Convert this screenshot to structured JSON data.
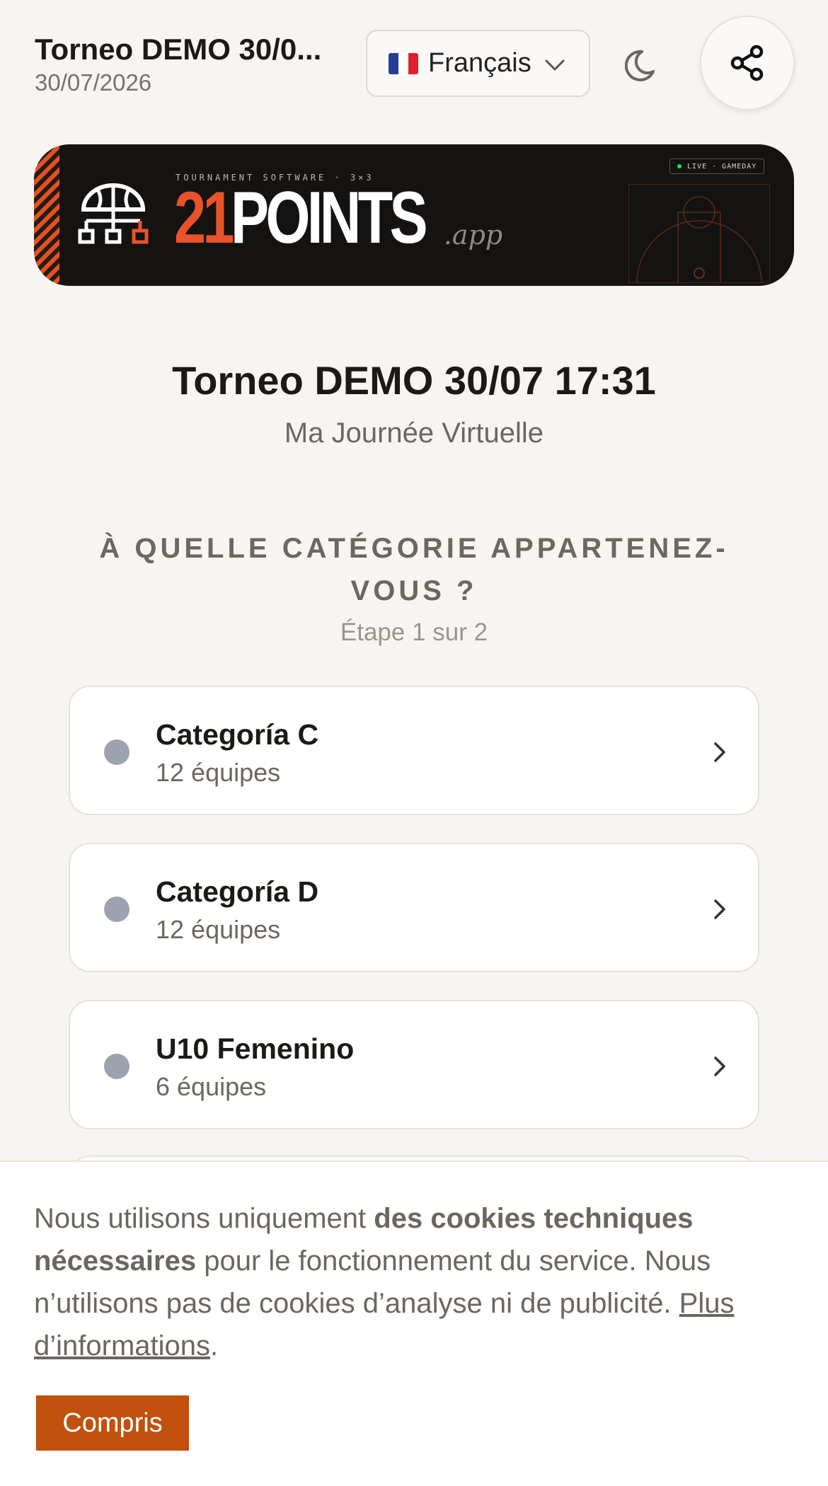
{
  "header": {
    "title": "Torneo DEMO 30/0...",
    "date": "30/07/2026",
    "language": {
      "selected": "Français",
      "flag_icon": "french-flag-icon"
    },
    "theme_icon": "moon-icon",
    "share_icon": "share-icon"
  },
  "banner": {
    "tagline": "TOURNAMENT SOFTWARE · 3×3",
    "brand_number": "21",
    "brand_word": "POINTS",
    "brand_suffix": ".app",
    "live_badge": "LIVE · GAMEDAY",
    "accent_color": "#e8532a"
  },
  "event": {
    "title": "Torneo DEMO 30/07 17:31",
    "subtitle": "Ma Journée Virtuelle"
  },
  "wizard": {
    "question": "À QUELLE CATÉGORIE APPARTENEZ-VOUS ?",
    "step": "Étape 1 sur 2"
  },
  "categories": [
    {
      "name": "Categoría C",
      "teams": "12 équipes"
    },
    {
      "name": "Categoría D",
      "teams": "12 équipes"
    },
    {
      "name": "U10 Femenino",
      "teams": "6 équipes"
    }
  ],
  "cookie_notice": {
    "text_before": "Nous utilisons uniquement ",
    "text_bold": "des cookies techniques nécessaires",
    "text_after": " pour le fonctionnement du service. Nous n’utilisons pas de cookies d’analyse ni de publicité. ",
    "link": "Plus d’informations",
    "link_suffix": ".",
    "button": "Compris",
    "button_color": "#c2510d"
  }
}
